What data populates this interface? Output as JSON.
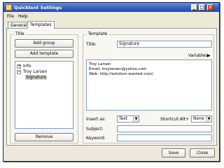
{
  "window": {
    "title": "Quicktext Settings"
  },
  "titlebar_buttons": {
    "minimize": "_",
    "maximize": "□",
    "close": "✕"
  },
  "menu": [
    "File",
    "Help"
  ],
  "tabs": [
    {
      "label": "General",
      "active": false
    },
    {
      "label": "Templates",
      "active": true
    }
  ],
  "title_group": {
    "heading": "Title",
    "add_group": "Add group",
    "add_template": "Add template",
    "tree": [
      {
        "label": "Info",
        "expander": "+",
        "level": 0
      },
      {
        "label": "Troy Larsen",
        "expander": "−",
        "level": 0
      },
      {
        "label": "Signature",
        "level": 1,
        "selected": true
      }
    ],
    "remove": "Remove"
  },
  "template_group": {
    "heading": "Template",
    "title_label": "Title:",
    "title_value": "Signature",
    "variables_label": "Variables",
    "variables_arrow": "▶",
    "body_lines": [
      "Troy Larsen",
      "Email: troylarsen@yahoo.com",
      "Web: http://solution-wanted.com/"
    ],
    "insert_as_label": "Insert as:",
    "insert_as_value": "Text",
    "shortcut_label": "Shortcut:",
    "shortcut_prefix": "Alt+",
    "shortcut_value": "None",
    "subject_label": "Subject:",
    "subject_value": "",
    "keyword_label": "Keyword:",
    "keyword_value": ""
  },
  "footer": {
    "save": "Save",
    "close": "Close"
  }
}
